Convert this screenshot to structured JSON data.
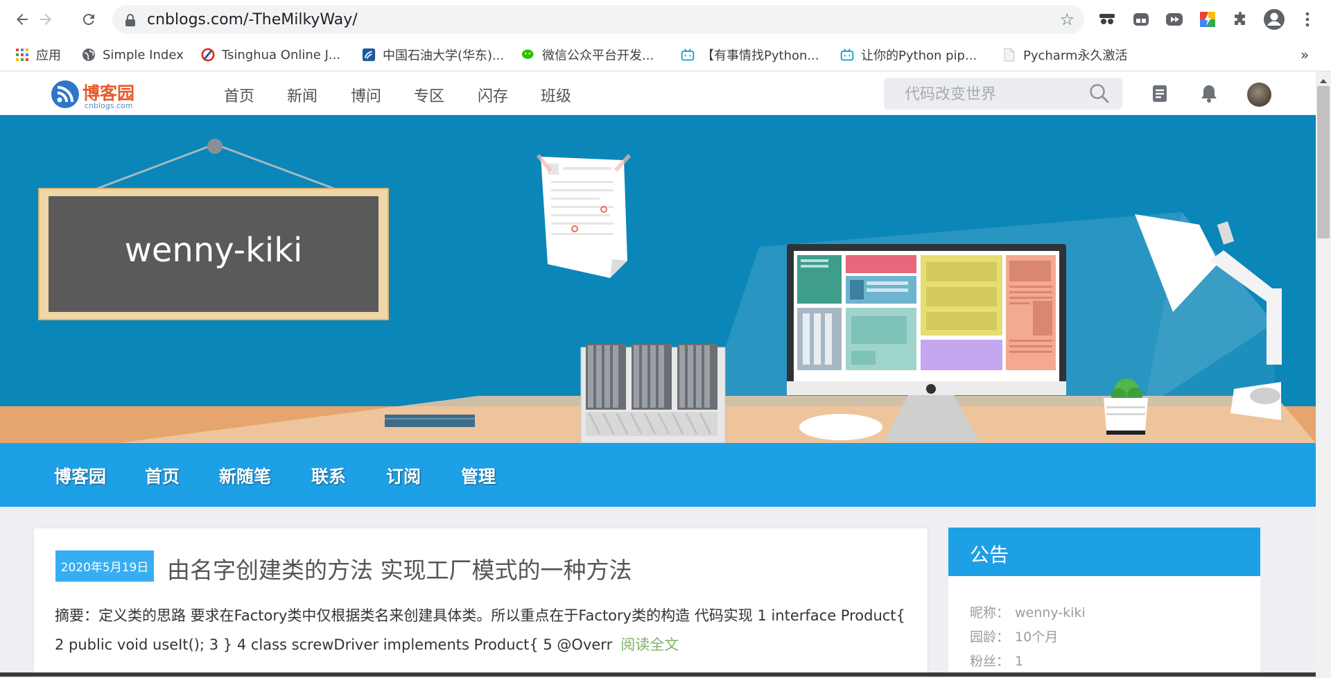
{
  "browser": {
    "url_host": "cnblogs.com",
    "url_path": "/-TheMilkyWay/",
    "bookmarks": [
      {
        "label": "应用",
        "icon": "apps-grid-icon"
      },
      {
        "label": "Simple Index",
        "icon": "globe-icon"
      },
      {
        "label": "Tsinghua Online J...",
        "icon": "tsinghua-icon"
      },
      {
        "label": "中国石油大学(华东)...",
        "icon": "upc-icon"
      },
      {
        "label": "微信公众平台开发...",
        "icon": "wechat-icon"
      },
      {
        "label": "【有事情找Python...",
        "icon": "bilibili-icon"
      },
      {
        "label": "让你的Python pip...",
        "icon": "bilibili-icon"
      },
      {
        "label": "Pycharm永久激活",
        "icon": "page-icon"
      }
    ],
    "more_bookmarks": "»"
  },
  "site": {
    "logo_text": "博客园",
    "logo_sub": "cnblogs.com",
    "nav": [
      "首页",
      "新闻",
      "博问",
      "专区",
      "闪存",
      "班级"
    ],
    "search_placeholder": "代码改变世界"
  },
  "blog": {
    "title": "wenny-kiki",
    "menu": [
      "博客园",
      "首页",
      "新随笔",
      "联系",
      "订阅",
      "管理"
    ]
  },
  "post": {
    "date": "2020年5月19日",
    "title": "由名字创建类的方法 实现工厂模式的一种方法",
    "abstract": "摘要：定义类的思路 要求在Factory类中仅根据类名来创建具体类。所以重点在于Factory类的构造 代码实现 1 interface Product{ 2 public void useIt(); 3 } 4 class screwDriver implements Product{ 5 @Overr",
    "read_more": "阅读全文"
  },
  "sidebar": {
    "heading": "公告",
    "rows": [
      {
        "label": "昵称：",
        "value": "wenny-kiki"
      },
      {
        "label": "园龄：",
        "value": "10个月"
      },
      {
        "label": "粉丝：",
        "value": "1"
      }
    ]
  },
  "colors": {
    "accent": "#1ea0e6",
    "date_badge": "#37aef2",
    "read_more": "#7fb261",
    "banner_bg": "#0a86b8"
  }
}
